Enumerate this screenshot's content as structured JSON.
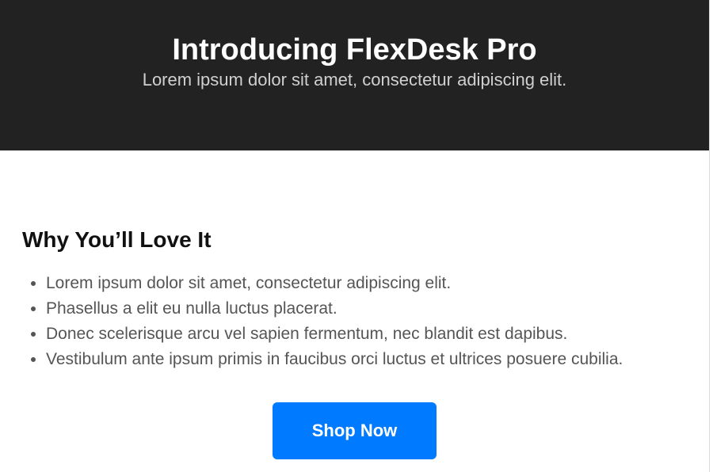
{
  "hero": {
    "title": "Introducing FlexDesk Pro",
    "subtitle": "Lorem ipsum dolor sit amet, consectetur adipiscing elit."
  },
  "features": {
    "title": "Why You’ll Love It",
    "items": [
      "Lorem ipsum dolor sit amet, consectetur adipiscing elit.",
      "Phasellus a elit eu nulla luctus placerat.",
      "Donec scelerisque arcu vel sapien fermentum, nec blandit est dapibus.",
      "Vestibulum ante ipsum primis in faucibus orci luctus et ultrices posuere cubilia."
    ]
  },
  "cta": {
    "label": "Shop Now"
  },
  "colors": {
    "hero_background": "#222222",
    "primary_button": "#007bff"
  }
}
